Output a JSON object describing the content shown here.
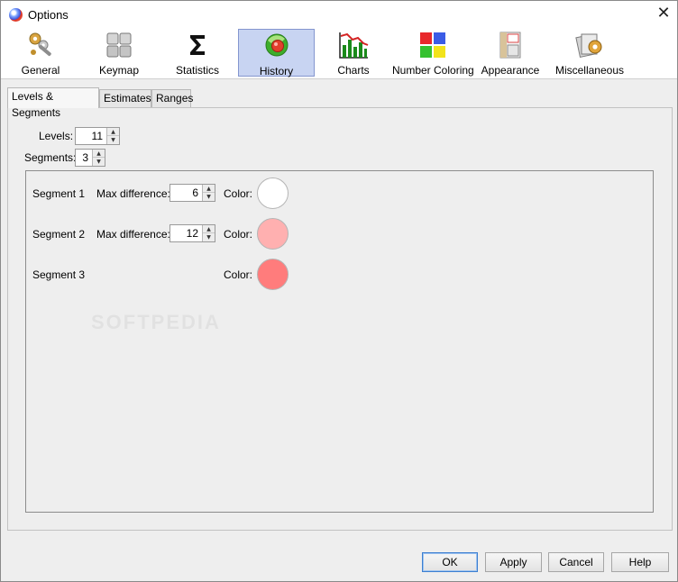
{
  "window": {
    "title": "Options",
    "close_glyph": "✕"
  },
  "toolbar": {
    "items": [
      {
        "label": "General",
        "icon": "gears-wrench-icon"
      },
      {
        "label": "Keymap",
        "icon": "keyboard-keys-icon"
      },
      {
        "label": "Statistics",
        "icon": "sigma-icon"
      },
      {
        "label": "History",
        "icon": "green-sphere-history-icon",
        "active": true
      },
      {
        "label": "Charts",
        "icon": "bar-chart-icon"
      },
      {
        "label": "Number Coloring",
        "icon": "color-squares-icon"
      },
      {
        "label": "Appearance",
        "icon": "appearance-panels-icon"
      },
      {
        "label": "Miscellaneous",
        "icon": "misc-gear-cards-icon"
      }
    ]
  },
  "tabs": [
    {
      "label": "Levels & Segments",
      "active": true
    },
    {
      "label": "Estimates"
    },
    {
      "label": "Ranges"
    }
  ],
  "levels": {
    "label": "Levels:",
    "value": "11"
  },
  "segments": {
    "label": "Segments:",
    "value": "3"
  },
  "segment_rows": [
    {
      "name": "Segment 1",
      "max_diff_label": "Max difference:",
      "max_diff": "6",
      "color_label": "Color:",
      "color": "#ffffff"
    },
    {
      "name": "Segment 2",
      "max_diff_label": "Max difference:",
      "max_diff": "12",
      "color_label": "Color:",
      "color": "#ffb0b0"
    },
    {
      "name": "Segment 3",
      "color_label": "Color:",
      "color": "#ff7c7c"
    }
  ],
  "buttons": {
    "ok": "OK",
    "apply": "Apply",
    "cancel": "Cancel",
    "help": "Help"
  },
  "watermark": "SOFTPEDIA"
}
